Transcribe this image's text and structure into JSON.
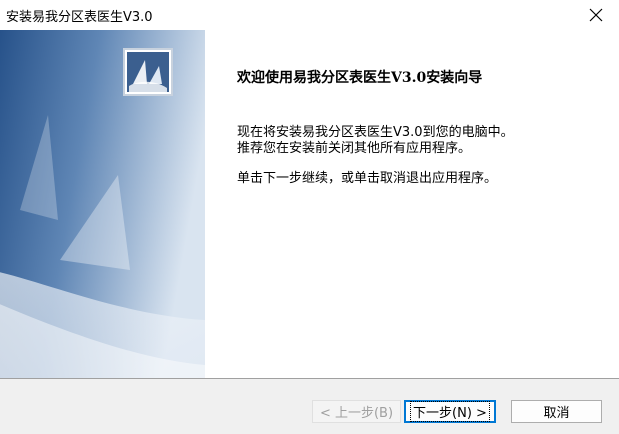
{
  "window": {
    "title": "安装易我分区表医生V3.0",
    "close_icon": "close-icon"
  },
  "content": {
    "heading": "欢迎使用易我分区表医生V3.0安装向导",
    "line1": "现在将安装易我分区表医生V3.0到您的电脑中。",
    "line2": "推荐您在安装前关闭其他所有应用程序。",
    "line3": "单击下一步继续，或单击取消退出应用程序。"
  },
  "buttons": {
    "back": "< 上一步(B)",
    "next": "下一步(N) >",
    "cancel": "取消"
  },
  "colors": {
    "side_panel_dark": "#1f4e89",
    "side_panel_light": "#dde6f1",
    "focus_border": "#0078d4",
    "footer_bg": "#f0f0f0"
  }
}
